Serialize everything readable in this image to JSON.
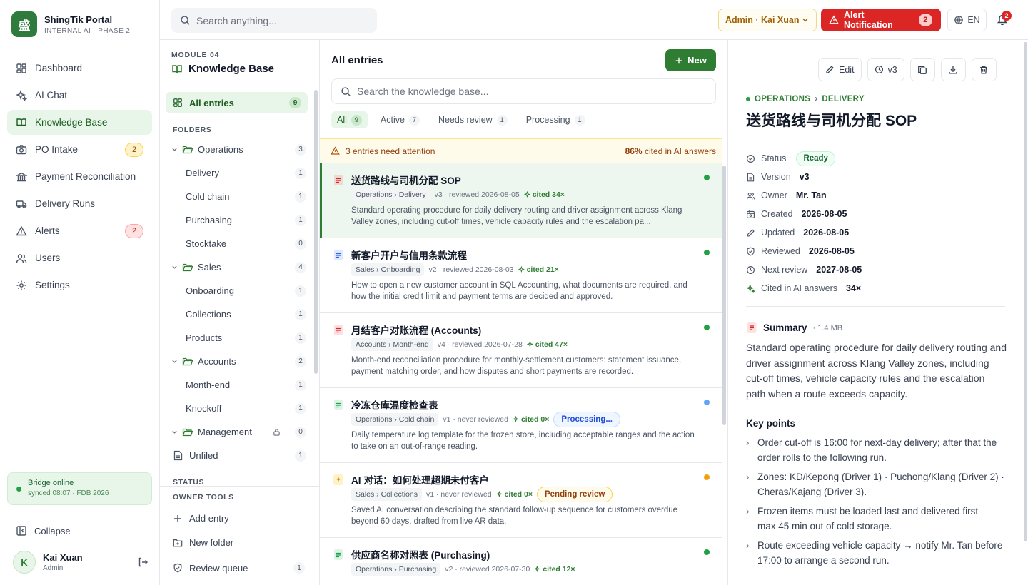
{
  "brand": {
    "name": "ShingTik Portal",
    "subtitle": "INTERNAL AI · PHASE 2",
    "logo_char": "盛"
  },
  "nav": [
    {
      "label": "Dashboard",
      "icon": "dashboard-icon"
    },
    {
      "label": "AI Chat",
      "icon": "sparkle-icon"
    },
    {
      "label": "Knowledge Base",
      "icon": "book-icon",
      "active": true
    },
    {
      "label": "PO Intake",
      "icon": "camera-icon",
      "badge": "2"
    },
    {
      "label": "Payment Reconciliation",
      "icon": "bank-icon"
    },
    {
      "label": "Delivery Runs",
      "icon": "truck-icon"
    },
    {
      "label": "Alerts",
      "icon": "warning-icon",
      "badge": "2"
    },
    {
      "label": "Users",
      "icon": "users-icon"
    },
    {
      "label": "Settings",
      "icon": "gear-icon"
    }
  ],
  "bridge": {
    "status": "Bridge online",
    "detail": "synced 08:07 · FDB 2026"
  },
  "collapse_label": "Collapse",
  "user": {
    "initial": "K",
    "name": "Kai Xuan",
    "role": "Admin"
  },
  "topbar": {
    "search_placeholder": "Search anything...",
    "admin_label": "Admin · Kai Xuan",
    "alert_label": "Alert Notification",
    "alert_count": "2",
    "lang": "EN",
    "bell_count": "2"
  },
  "module": {
    "label": "MODULE 04",
    "title": "Knowledge Base"
  },
  "all_entries": {
    "label": "All entries",
    "count": "9"
  },
  "folders_label": "FOLDERS",
  "folders": [
    {
      "label": "Operations",
      "count": "3",
      "level": 0
    },
    {
      "label": "Delivery",
      "count": "1",
      "level": 1
    },
    {
      "label": "Cold chain",
      "count": "1",
      "level": 1
    },
    {
      "label": "Purchasing",
      "count": "1",
      "level": 1
    },
    {
      "label": "Stocktake",
      "count": "0",
      "level": 1
    },
    {
      "label": "Sales",
      "count": "4",
      "level": 0
    },
    {
      "label": "Onboarding",
      "count": "1",
      "level": 1
    },
    {
      "label": "Collections",
      "count": "1",
      "level": 1
    },
    {
      "label": "Products",
      "count": "1",
      "level": 1
    },
    {
      "label": "Accounts",
      "count": "2",
      "level": 0
    },
    {
      "label": "Month-end",
      "count": "1",
      "level": 1
    },
    {
      "label": "Knockoff",
      "count": "1",
      "level": 1
    },
    {
      "label": "Management",
      "count": "0",
      "level": 0,
      "locked": true
    },
    {
      "label": "Unfiled",
      "count": "1",
      "level": 2
    }
  ],
  "status_label": "STATUS",
  "owner_tools": {
    "label": "OWNER TOOLS",
    "items": [
      {
        "label": "Add entry",
        "icon": "plus-icon"
      },
      {
        "label": "New folder",
        "icon": "folder-plus-icon"
      },
      {
        "label": "Review queue",
        "icon": "shield-check-icon",
        "count": "1"
      }
    ]
  },
  "list": {
    "title": "All entries",
    "new_label": "New",
    "search_placeholder": "Search the knowledge base...",
    "filters": [
      {
        "label": "All",
        "count": "9",
        "active": true
      },
      {
        "label": "Active",
        "count": "7"
      },
      {
        "label": "Needs review",
        "count": "1"
      },
      {
        "label": "Processing",
        "count": "1"
      }
    ],
    "attention_text": "3 entries need attention",
    "cited_pct": "86%",
    "cited_text": "cited in AI answers"
  },
  "entries": [
    {
      "title": "送货路线与司机分配 SOP",
      "path": "Operations › Delivery",
      "meta": "v3 · reviewed 2026-08-05",
      "cited": "cited 34×",
      "desc": "Standard operating procedure for daily delivery routing and driver assignment across Klang Valley zones, including cut-off times, vehicle capacity rules and the escalation pa...",
      "file_color": "#dc2626",
      "dot": "#22a045",
      "selected": true
    },
    {
      "title": "新客户开户与信用条款流程",
      "path": "Sales › Onboarding",
      "meta": "v2 · reviewed 2026-08-03",
      "cited": "cited 21×",
      "desc": "How to open a new customer account in SQL Accounting, what documents are required, and how the initial credit limit and payment terms are decided and approved.",
      "file_color": "#2563eb",
      "dot": "#22a045"
    },
    {
      "title": "月结客户对账流程 (Accounts)",
      "path": "Accounts › Month-end",
      "meta": "v4 · reviewed 2026-07-28",
      "cited": "cited 47×",
      "desc": "Month-end reconciliation procedure for monthly-settlement customers: statement issuance, payment matching order, and how disputes and short payments are recorded.",
      "file_color": "#dc2626",
      "dot": "#22a045"
    },
    {
      "title": "冷冻仓库温度检查表",
      "path": "Operations › Cold chain",
      "meta": "v1 · never reviewed",
      "cited": "cited 0×",
      "tag": "Processing...",
      "tag_type": "proc",
      "desc": "Daily temperature log template for the frozen store, including acceptable ranges and the action to take on an out-of-range reading.",
      "file_color": "#16a34a",
      "dot": "#60a5fa"
    },
    {
      "title": "AI 对话：如何处理超期未付客户",
      "path": "Sales › Collections",
      "meta": "v1 · never reviewed",
      "cited": "cited 0×",
      "tag": "Pending review",
      "tag_type": "pend",
      "desc": "Saved AI conversation describing the standard follow-up sequence for customers overdue beyond 60 days, drafted from live AR data.",
      "file_color": "#d97706",
      "dot": "#f59e0b",
      "ai": true
    },
    {
      "title": "供应商名称对照表 (Purchasing)",
      "path": "Operations › Purchasing",
      "meta": "v2 · reviewed 2026-07-30",
      "cited": "cited 12×",
      "desc": "",
      "file_color": "#16a34a",
      "dot": "#22a045"
    }
  ],
  "detail": {
    "tools": {
      "edit": "Edit",
      "version": "v3"
    },
    "crumb": [
      "OPERATIONS",
      "DELIVERY"
    ],
    "title": "送货路线与司机分配 SOP",
    "props": [
      {
        "label": "Status",
        "value": "Ready",
        "icon": "check-circle-icon",
        "pill": true
      },
      {
        "label": "Version",
        "value": "v3",
        "icon": "file-icon"
      },
      {
        "label": "Owner",
        "value": "Mr. Tan",
        "icon": "user-icon"
      },
      {
        "label": "Created",
        "value": "2026-08-05",
        "icon": "calendar-icon"
      },
      {
        "label": "Updated",
        "value": "2026-08-05",
        "icon": "pencil-icon"
      },
      {
        "label": "Reviewed",
        "value": "2026-08-05",
        "icon": "shield-check-icon"
      },
      {
        "label": "Next review",
        "value": "2027-08-05",
        "icon": "clock-icon"
      },
      {
        "label": "Cited in AI answers",
        "value": "34×",
        "icon": "sparkle-icon"
      }
    ],
    "summary_label": "Summary",
    "file_size": "· 1.4 MB",
    "summary": "Standard operating procedure for daily delivery routing and driver assignment across Klang Valley zones, including cut-off times, vehicle capacity rules and the escalation path when a route exceeds capacity.",
    "key_points_label": "Key points",
    "key_points": [
      "Order cut-off is 16:00 for next-day delivery; after that the order rolls to the following run.",
      "Zones: KD/Kepong (Driver 1) · Puchong/Klang (Driver 2) · Cheras/Kajang (Driver 3).",
      "Frozen items must be loaded last and delivered first — max 45 min out of cold storage.",
      "Route exceeding vehicle capacity → notify Mr. Tan before 17:00 to arrange a second run."
    ]
  }
}
